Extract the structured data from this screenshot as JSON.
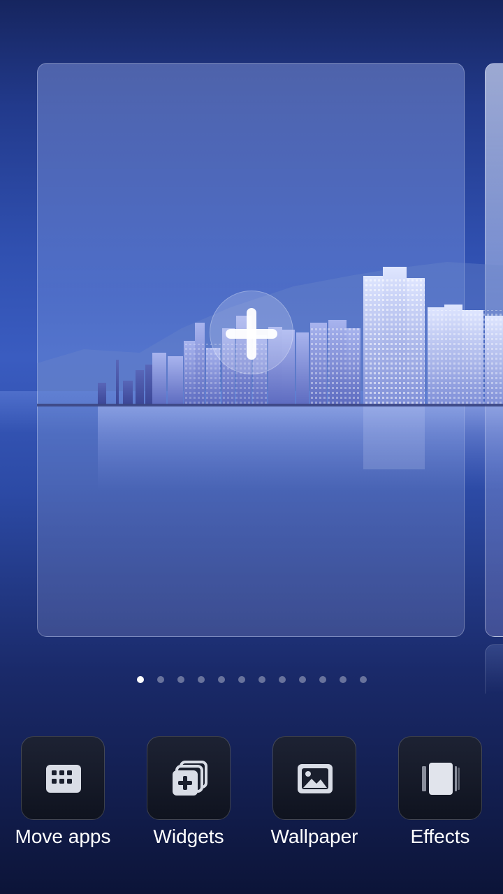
{
  "screen": "home-screen-edit-mode",
  "page_card": {
    "action": "add-page"
  },
  "page_indicator": {
    "total": 12,
    "active_index": 0
  },
  "toolbar": {
    "items": [
      {
        "id": "move-apps",
        "label": "Move apps",
        "icon": "app-grid-icon"
      },
      {
        "id": "widgets",
        "label": "Widgets",
        "icon": "add-widget-icon"
      },
      {
        "id": "wallpaper",
        "label": "Wallpaper",
        "icon": "image-icon"
      },
      {
        "id": "effects",
        "label": "Effects",
        "icon": "transition-effect-icon"
      }
    ]
  },
  "colors": {
    "background_top": "#16255f",
    "background_mid": "#3a5cc0",
    "background_bottom": "#0c1438",
    "tile": "#151a28",
    "label": "#ffffff"
  }
}
